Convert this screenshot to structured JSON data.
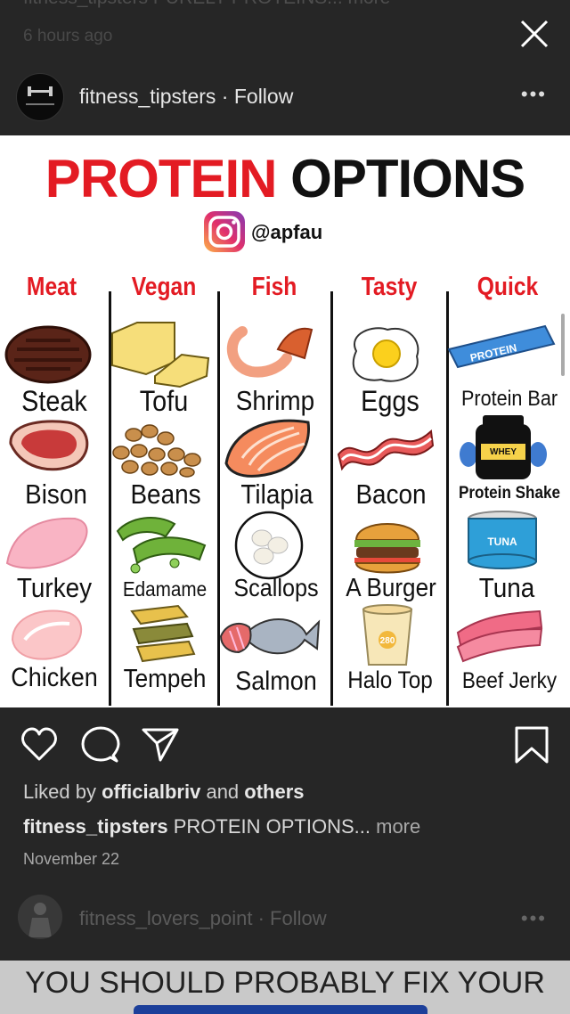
{
  "previous_post": {
    "caption": "fitness_tipsters PURELY PROTEINS... more",
    "time": "6 hours ago"
  },
  "post": {
    "username": "fitness_tipsters",
    "follow_label": "Follow",
    "more_label": "•••",
    "image": {
      "title_part1": "PROTEIN",
      "title_part2": "OPTIONS",
      "handle": "@apfau",
      "columns": [
        {
          "heading": "Meat",
          "items": [
            "Steak",
            "Bison",
            "Turkey",
            "Chicken"
          ]
        },
        {
          "heading": "Vegan",
          "items": [
            "Tofu",
            "Beans",
            "Edamame",
            "Tempeh"
          ]
        },
        {
          "heading": "Fish",
          "items": [
            "Shrimp",
            "Tilapia",
            "Scallops",
            "Salmon"
          ]
        },
        {
          "heading": "Tasty",
          "items": [
            "Eggs",
            "Bacon",
            "A Burger",
            "Halo Top"
          ]
        },
        {
          "heading": "Quick",
          "items": [
            "Protein Bar",
            "Protein Shake",
            "Tuna",
            "Beef Jerky"
          ]
        }
      ],
      "protein_bar_text": "PROTEIN",
      "whey_text": "WHEY",
      "tuna_text": "TUNA",
      "halo_text": "280"
    },
    "likes_prefix": "Liked by",
    "likes_user": "officialbriv",
    "likes_and": "and",
    "likes_others": "others",
    "caption_user": "fitness_tipsters",
    "caption_text": "PROTEIN OPTIONS...",
    "caption_more": "more",
    "date": "November 22"
  },
  "next_post": {
    "username": "fitness_lovers_point",
    "follow_label": "Follow",
    "image_text": "YOU SHOULD PROBABLY FIX YOUR"
  },
  "colors": {
    "accent_red": "#e31b23",
    "background": "#262626"
  }
}
